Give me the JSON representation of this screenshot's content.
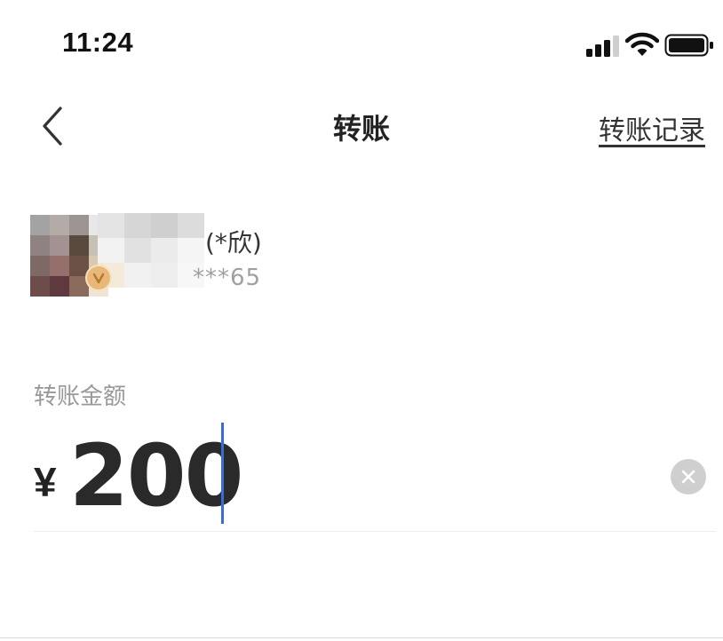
{
  "status_bar": {
    "time": "11:24",
    "icons": [
      "signal-icon",
      "wifi-icon",
      "battery-icon"
    ]
  },
  "nav": {
    "back_icon": "chevron-left-icon",
    "title": "转账",
    "records_link": "转账记录"
  },
  "recipient": {
    "avatar": "blurred-avatar",
    "badge_icon": "vip-badge-icon",
    "name_suffix": "(*欣)",
    "account_suffix": "***65"
  },
  "amount": {
    "label": "转账金额",
    "currency_symbol": "¥",
    "value": "200",
    "clear_icon": "clear-icon"
  },
  "colors": {
    "caret": "#3d6ad6",
    "badge": "#e9b878",
    "muted_text": "#a0a0a0"
  }
}
